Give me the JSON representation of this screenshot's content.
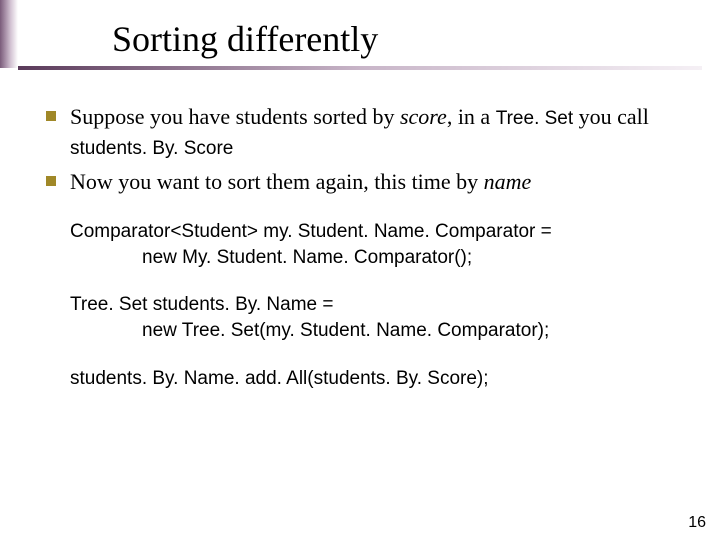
{
  "title": "Sorting differently",
  "bullets": [
    {
      "run1": "Suppose you have students sorted by ",
      "emph": "score",
      "run2": ", in a ",
      "code1": "Tree. Set",
      "run3": " you call",
      "code_line2": "students. By. Score"
    },
    {
      "run1": "Now you want to sort them again, this time by ",
      "emph": "name"
    }
  ],
  "code": [
    {
      "l1": "Comparator<Student> my. Student. Name. Comparator =",
      "l2": "new My. Student. Name. Comparator();"
    },
    {
      "l1": "Tree. Set students. By. Name =",
      "l2": "new Tree. Set(my. Student. Name. Comparator);"
    },
    {
      "l1": "students. By. Name. add. All(students. By. Score);"
    }
  ],
  "page_number": "16"
}
